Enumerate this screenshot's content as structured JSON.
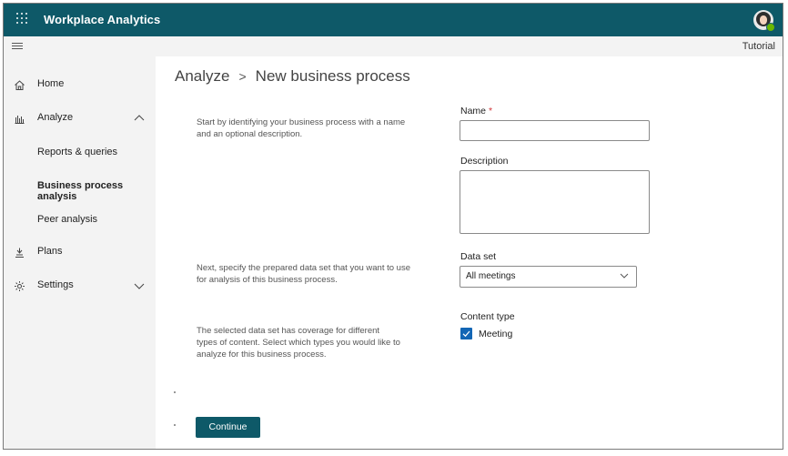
{
  "app": {
    "title": "Workplace Analytics"
  },
  "subbar": {
    "tutorial_label": "Tutorial"
  },
  "sidebar": {
    "items": [
      {
        "label": "Home",
        "icon": "home-icon"
      },
      {
        "label": "Analyze",
        "icon": "bar-chart-icon",
        "expanded": true
      },
      {
        "label": "Plans",
        "icon": "plans-icon"
      },
      {
        "label": "Settings",
        "icon": "gear-icon",
        "expanded": false
      }
    ],
    "analyze_children": [
      {
        "label": "Reports & queries",
        "active": false
      },
      {
        "label": "Business process analysis",
        "active": true
      },
      {
        "label": "Peer analysis",
        "active": false
      }
    ]
  },
  "breadcrumb": {
    "root": "Analyze",
    "separator": ">",
    "current": "New business process"
  },
  "form": {
    "intro_help": "Start by identifying your business process with a name and an optional description.",
    "name_label": "Name",
    "required_marker": "*",
    "name_value": "",
    "description_label": "Description",
    "description_value": "",
    "dataset_help": "Next, specify the prepared data set that you want to use for analysis of this business process.",
    "dataset_label": "Data set",
    "dataset_value": "All meetings",
    "content_help": "The selected data set has coverage for different types of content. Select which types you would like to analyze for this business process.",
    "content_type_label": "Content type",
    "content_types": [
      {
        "label": "Meeting",
        "checked": true
      }
    ],
    "continue_label": "Continue"
  },
  "colors": {
    "topbar": "#0e5968",
    "accent": "#1366b5",
    "required": "#d13438",
    "presence": "#6bb700"
  }
}
